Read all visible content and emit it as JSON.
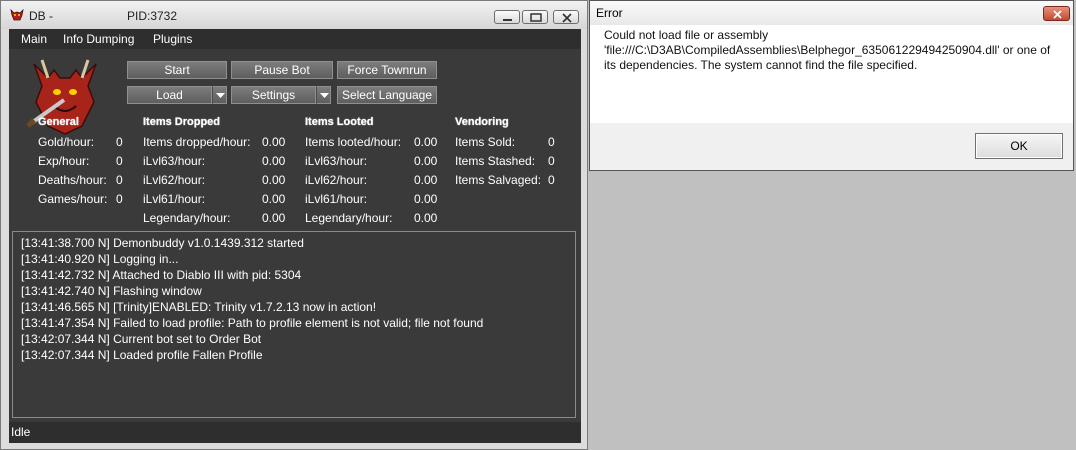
{
  "db_window": {
    "title": "DB -",
    "pid": "PID:3732",
    "menu": [
      "Main",
      "Info Dumping",
      "Plugins"
    ],
    "buttons": {
      "start": "Start",
      "pause_bot": "Pause Bot",
      "force_townrun": "Force Townrun",
      "load": "Load",
      "settings": "Settings",
      "select_language": "Select Language"
    },
    "stats": {
      "general": {
        "header": "General",
        "rows": [
          {
            "label": "Gold/hour:",
            "value": "0"
          },
          {
            "label": "Exp/hour:",
            "value": "0"
          },
          {
            "label": "Deaths/hour:",
            "value": "0"
          },
          {
            "label": "Games/hour:",
            "value": "0"
          }
        ]
      },
      "items_dropped": {
        "header": "Items Dropped",
        "rows": [
          {
            "label": "Items dropped/hour:",
            "value": "0.00"
          },
          {
            "label": "iLvl63/hour:",
            "value": "0.00"
          },
          {
            "label": "iLvl62/hour:",
            "value": "0.00"
          },
          {
            "label": "iLvl61/hour:",
            "value": "0.00"
          },
          {
            "label": "Legendary/hour:",
            "value": "0.00"
          }
        ]
      },
      "items_looted": {
        "header": "Items Looted",
        "rows": [
          {
            "label": "Items looted/hour:",
            "value": "0.00"
          },
          {
            "label": "iLvl63/hour:",
            "value": "0.00"
          },
          {
            "label": "iLvl62/hour:",
            "value": "0.00"
          },
          {
            "label": "iLvl61/hour:",
            "value": "0.00"
          },
          {
            "label": "Legendary/hour:",
            "value": "0.00"
          }
        ]
      },
      "vendoring": {
        "header": "Vendoring",
        "rows": [
          {
            "label": "Items Sold:",
            "value": "0"
          },
          {
            "label": "Items Stashed:",
            "value": "0"
          },
          {
            "label": "Items Salvaged:",
            "value": "0"
          }
        ]
      }
    },
    "log": [
      "[13:41:38.700 N] Demonbuddy v1.0.1439.312 started",
      "[13:41:40.920 N] Logging in...",
      "[13:41:42.732 N] Attached to Diablo III with pid: 5304",
      "[13:41:42.740 N] Flashing window",
      "[13:41:46.565 N] [Trinity]ENABLED: Trinity v1.7.2.13 now in action!",
      "[13:41:47.354 N] Failed to load profile: Path to profile element is not valid; file not found",
      "[13:42:07.344 N] Current bot set to Order Bot",
      "[13:42:07.344 N] Loaded profile Fallen Profile"
    ],
    "status": "Idle"
  },
  "error_dialog": {
    "title": "Error",
    "message": "Could not load file or assembly 'file:///C:\\D3AB\\CompiledAssemblies\\Belphegor_635061229494250904.dll' or one of its dependencies. The system cannot find the file specified.",
    "ok_label": "OK"
  },
  "colors": {
    "client_bg": "#3a3a3a",
    "menubar_bg": "#2e2e2e",
    "desktop_bg": "#c0c0c0",
    "close_red": "#c34b32"
  },
  "icons": [
    "demon-app-icon",
    "minimize-icon",
    "maximize-icon",
    "close-icon",
    "dropdown-arrow-icon",
    "demonbuddy-logo"
  ]
}
